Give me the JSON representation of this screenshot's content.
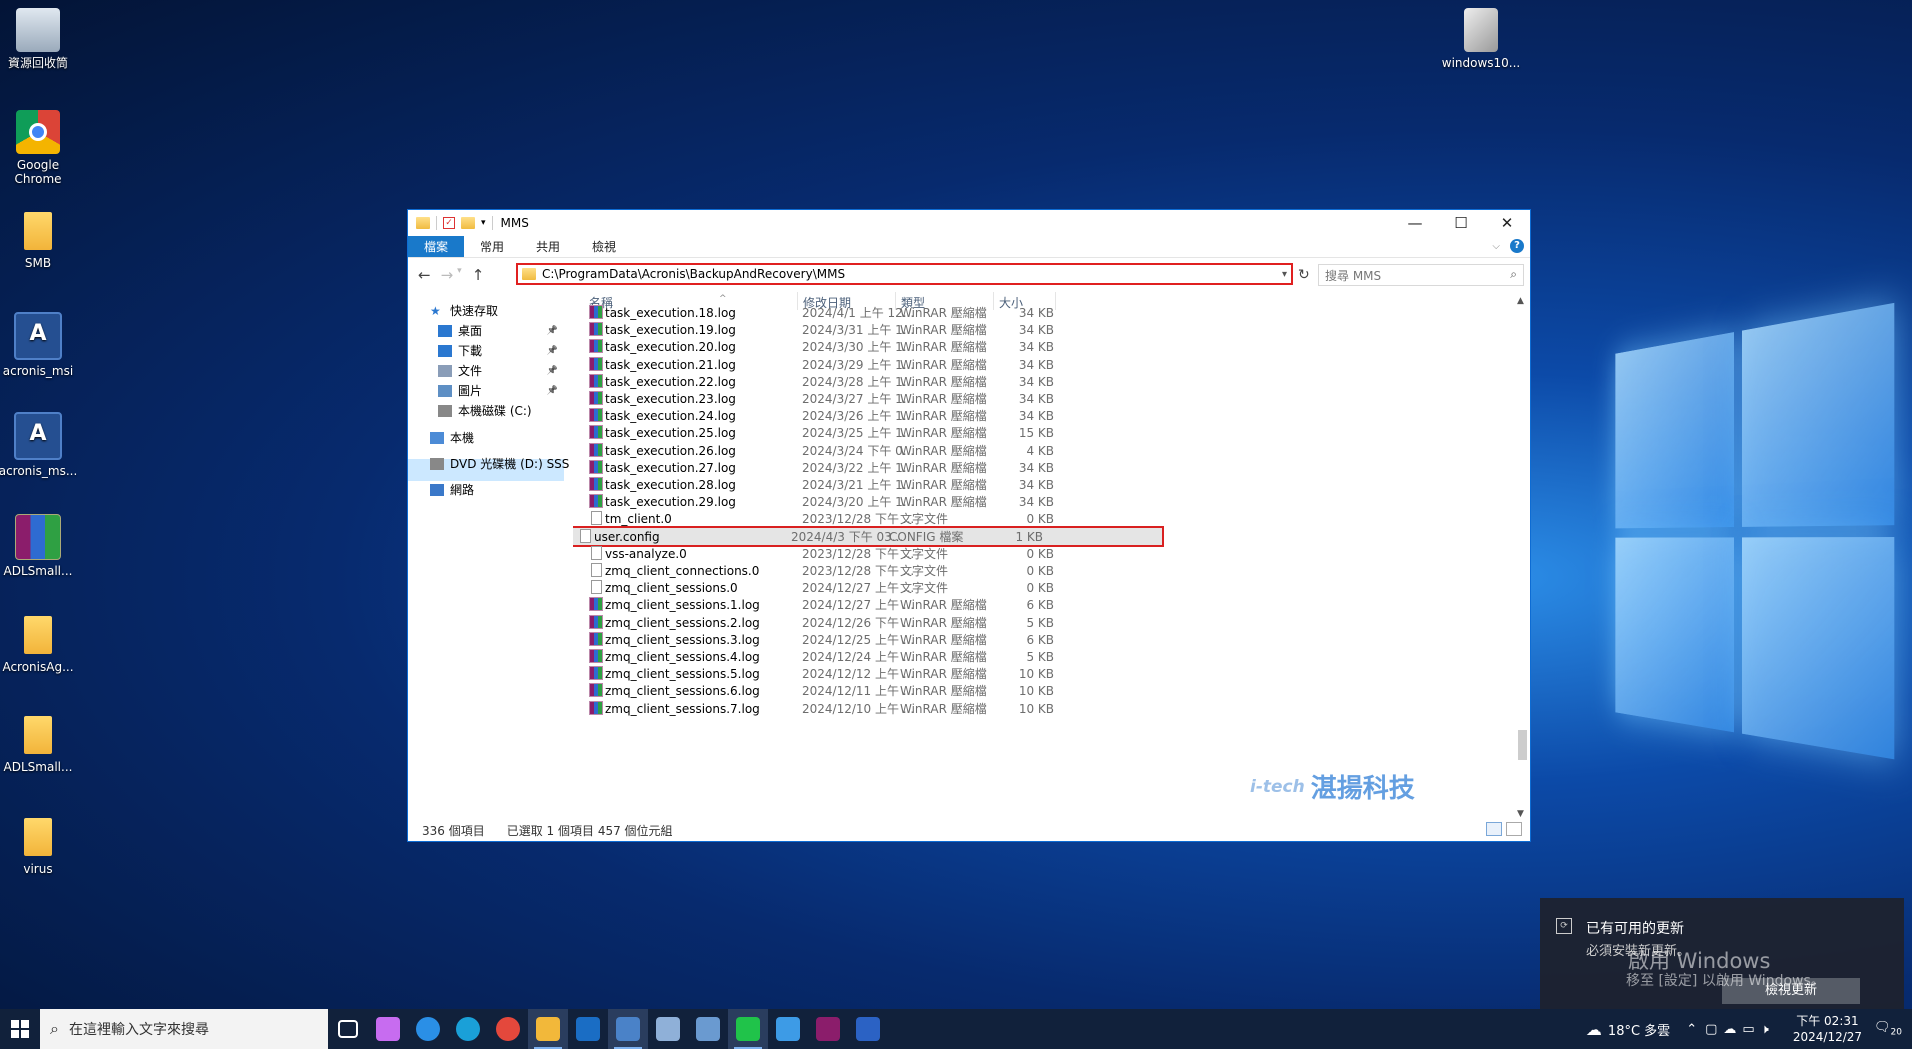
{
  "desktop": {
    "icons_left": [
      {
        "label": "資源回收筒",
        "kind": "bin"
      },
      {
        "label": "Google Chrome",
        "kind": "chrome"
      },
      {
        "label": "SMB",
        "kind": "folder"
      },
      {
        "label": "acronis_msi",
        "kind": "acronis"
      },
      {
        "label": "acronis_ms...",
        "kind": "acronis"
      },
      {
        "label": "ADLSmall...",
        "kind": "rar"
      },
      {
        "label": "AcronisAg...",
        "kind": "folder"
      },
      {
        "label": "ADLSmall...",
        "kind": "folder"
      },
      {
        "label": "virus",
        "kind": "folder"
      }
    ],
    "icon_right": {
      "label": "windows10...",
      "kind": "disc"
    }
  },
  "explorer": {
    "title": "MMS",
    "ribbon_tabs": [
      "檔案",
      "常用",
      "共用",
      "檢視"
    ],
    "address": "C:\\ProgramData\\Acronis\\BackupAndRecovery\\MMS",
    "search_placeholder": "搜尋 MMS",
    "nav": [
      {
        "label": "快速存取",
        "icon": "star-icon",
        "indent": 0,
        "pinned": false
      },
      {
        "label": "桌面",
        "icon": "desktop-icon",
        "indent": 1,
        "pinned": true
      },
      {
        "label": "下載",
        "icon": "download-icon",
        "indent": 1,
        "pinned": true
      },
      {
        "label": "文件",
        "icon": "document-icon",
        "indent": 1,
        "pinned": true
      },
      {
        "label": "圖片",
        "icon": "picture-icon",
        "indent": 1,
        "pinned": true
      },
      {
        "label": "本機磁碟 (C:)",
        "icon": "drive-icon",
        "indent": 1,
        "pinned": false
      },
      {
        "label": "本機",
        "icon": "pc-icon",
        "indent": 0,
        "pinned": false,
        "selected": true
      },
      {
        "label": "DVD 光碟機 (D:) SSS",
        "icon": "dvd-icon",
        "indent": 0,
        "pinned": false
      },
      {
        "label": "網路",
        "icon": "network-icon",
        "indent": 0,
        "pinned": false
      }
    ],
    "columns": [
      "名稱",
      "修改日期",
      "類型",
      "大小"
    ],
    "files": [
      {
        "name": "task_execution.18.log",
        "date": "2024/4/1 上午 12...",
        "type": "WinRAR 壓縮檔",
        "size": "34 KB",
        "kind": "rar"
      },
      {
        "name": "task_execution.19.log",
        "date": "2024/3/31 上午 1...",
        "type": "WinRAR 壓縮檔",
        "size": "34 KB",
        "kind": "rar"
      },
      {
        "name": "task_execution.20.log",
        "date": "2024/3/30 上午 1...",
        "type": "WinRAR 壓縮檔",
        "size": "34 KB",
        "kind": "rar"
      },
      {
        "name": "task_execution.21.log",
        "date": "2024/3/29 上午 1...",
        "type": "WinRAR 壓縮檔",
        "size": "34 KB",
        "kind": "rar"
      },
      {
        "name": "task_execution.22.log",
        "date": "2024/3/28 上午 1...",
        "type": "WinRAR 壓縮檔",
        "size": "34 KB",
        "kind": "rar"
      },
      {
        "name": "task_execution.23.log",
        "date": "2024/3/27 上午 1...",
        "type": "WinRAR 壓縮檔",
        "size": "34 KB",
        "kind": "rar"
      },
      {
        "name": "task_execution.24.log",
        "date": "2024/3/26 上午 1...",
        "type": "WinRAR 壓縮檔",
        "size": "34 KB",
        "kind": "rar"
      },
      {
        "name": "task_execution.25.log",
        "date": "2024/3/25 上午 1...",
        "type": "WinRAR 壓縮檔",
        "size": "15 KB",
        "kind": "rar"
      },
      {
        "name": "task_execution.26.log",
        "date": "2024/3/24 下午 0...",
        "type": "WinRAR 壓縮檔",
        "size": "4 KB",
        "kind": "rar"
      },
      {
        "name": "task_execution.27.log",
        "date": "2024/3/22 上午 1...",
        "type": "WinRAR 壓縮檔",
        "size": "34 KB",
        "kind": "rar"
      },
      {
        "name": "task_execution.28.log",
        "date": "2024/3/21 上午 1...",
        "type": "WinRAR 壓縮檔",
        "size": "34 KB",
        "kind": "rar"
      },
      {
        "name": "task_execution.29.log",
        "date": "2024/3/20 上午 1...",
        "type": "WinRAR 壓縮檔",
        "size": "34 KB",
        "kind": "rar"
      },
      {
        "name": "tm_client.0",
        "date": "2023/12/28 下午 ...",
        "type": "文字文件",
        "size": "0 KB",
        "kind": "doc"
      },
      {
        "name": "user.config",
        "date": "2024/4/3 下午 03...",
        "type": "CONFIG 檔案",
        "size": "1 KB",
        "kind": "doc",
        "selected": true
      },
      {
        "name": "vss-analyze.0",
        "date": "2023/12/28 下午 ...",
        "type": "文字文件",
        "size": "0 KB",
        "kind": "doc"
      },
      {
        "name": "zmq_client_connections.0",
        "date": "2023/12/28 下午 ...",
        "type": "文字文件",
        "size": "0 KB",
        "kind": "doc"
      },
      {
        "name": "zmq_client_sessions.0",
        "date": "2024/12/27 上午 ...",
        "type": "文字文件",
        "size": "0 KB",
        "kind": "doc"
      },
      {
        "name": "zmq_client_sessions.1.log",
        "date": "2024/12/27 上午 ...",
        "type": "WinRAR 壓縮檔",
        "size": "6 KB",
        "kind": "rar"
      },
      {
        "name": "zmq_client_sessions.2.log",
        "date": "2024/12/26 下午 ...",
        "type": "WinRAR 壓縮檔",
        "size": "5 KB",
        "kind": "rar"
      },
      {
        "name": "zmq_client_sessions.3.log",
        "date": "2024/12/25 上午 ...",
        "type": "WinRAR 壓縮檔",
        "size": "6 KB",
        "kind": "rar"
      },
      {
        "name": "zmq_client_sessions.4.log",
        "date": "2024/12/24 上午 ...",
        "type": "WinRAR 壓縮檔",
        "size": "5 KB",
        "kind": "rar"
      },
      {
        "name": "zmq_client_sessions.5.log",
        "date": "2024/12/12 上午 ...",
        "type": "WinRAR 壓縮檔",
        "size": "10 KB",
        "kind": "rar"
      },
      {
        "name": "zmq_client_sessions.6.log",
        "date": "2024/12/11 上午 ...",
        "type": "WinRAR 壓縮檔",
        "size": "10 KB",
        "kind": "rar"
      },
      {
        "name": "zmq_client_sessions.7.log",
        "date": "2024/12/10 上午 ...",
        "type": "WinRAR 壓縮檔",
        "size": "10 KB",
        "kind": "rar"
      }
    ],
    "status": {
      "count": "336 個項目",
      "selection": "已選取 1 個項目 457 個位元組"
    }
  },
  "watermark": {
    "brand": "i-tech",
    "name": "湛揚科技"
  },
  "notification": {
    "title": "已有可用的更新",
    "body": "必須安裝新更新。",
    "button": "檢視更新",
    "activate_title": "啟用 Windows",
    "activate_body": "移至 [設定] 以啟用 Windows。"
  },
  "taskbar": {
    "search_placeholder": "在這裡輸入文字來搜尋",
    "weather": "18°C 多雲",
    "time": "下午 02:31",
    "date": "2024/12/27",
    "notif_count": "20",
    "apps": [
      "task-view",
      "copilot",
      "ie",
      "edge",
      "chrome",
      "file-explorer",
      "outlook",
      "remote-desktop",
      "network-tool",
      "server-tool",
      "line",
      "paint",
      "winrar",
      "word"
    ]
  },
  "colors": {
    "accent": "#1979ca",
    "highlight_red": "#e02020",
    "selection": "#cce8ff"
  }
}
